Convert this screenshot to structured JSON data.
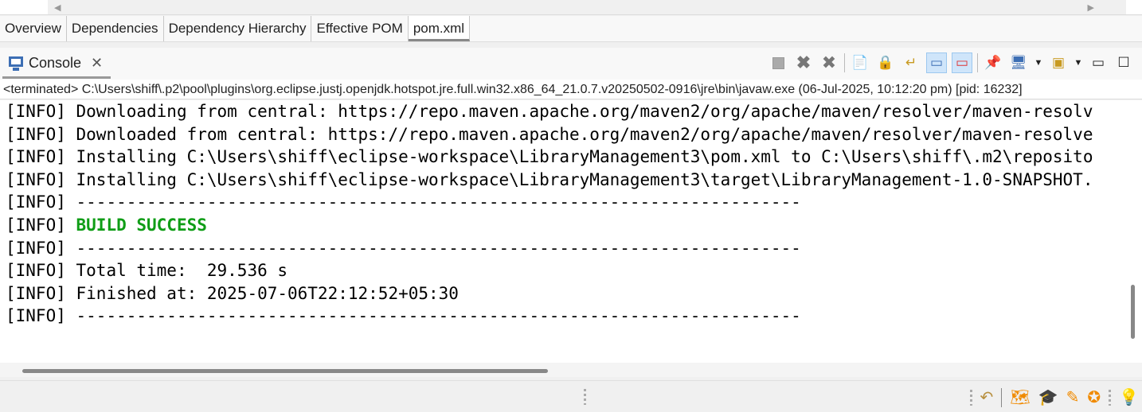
{
  "editor_tabs": [
    {
      "label": "Overview"
    },
    {
      "label": "Dependencies"
    },
    {
      "label": "Dependency Hierarchy"
    },
    {
      "label": "Effective POM"
    },
    {
      "label": "pom.xml",
      "active": true
    }
  ],
  "console_view": {
    "tab_label": "Console",
    "path": "<terminated> C:\\Users\\shiff\\.p2\\pool\\plugins\\org.eclipse.justj.openjdk.hotspot.jre.full.win32.x86_64_21.0.7.v20250502-0916\\jre\\bin\\javaw.exe (06-Jul-2025, 10:12:20 pm) [pid: 16232]"
  },
  "toolbar": [
    "terminate-icon",
    "remove-launch-icon",
    "remove-all-terminated-icon",
    "clear-console-icon",
    "scroll-lock-icon",
    "word-wrap-icon",
    "show-on-stdout-icon",
    "show-on-stderr-icon",
    "pin-console-icon",
    "display-selected-console-icon",
    "open-console-icon",
    "minimize-icon",
    "maximize-icon"
  ],
  "lines": [
    {
      "prefix": "[INFO] ",
      "text": "Downloading from central: https://repo.maven.apache.org/maven2/org/apache/maven/resolver/maven-resolv"
    },
    {
      "prefix": "[INFO] ",
      "text": "Downloaded from central: https://repo.maven.apache.org/maven2/org/apache/maven/resolver/maven-resolve"
    },
    {
      "prefix": "[INFO] ",
      "text": "Installing C:\\Users\\shiff\\eclipse-workspace\\LibraryManagement3\\pom.xml to C:\\Users\\shiff\\.m2\\reposito"
    },
    {
      "prefix": "[INFO] ",
      "text": "Installing C:\\Users\\shiff\\eclipse-workspace\\LibraryManagement3\\target\\LibraryManagement-1.0-SNAPSHOT."
    },
    {
      "prefix": "[INFO] ",
      "text": "------------------------------------------------------------------------"
    },
    {
      "prefix": "[INFO] ",
      "text": "BUILD SUCCESS",
      "success": true
    },
    {
      "prefix": "[INFO] ",
      "text": "------------------------------------------------------------------------"
    },
    {
      "prefix": "[INFO] ",
      "text": "Total time:  29.536 s"
    },
    {
      "prefix": "[INFO] ",
      "text": "Finished at: 2025-07-06T22:12:52+05:30"
    },
    {
      "prefix": "[INFO] ",
      "text": "------------------------------------------------------------------------"
    }
  ],
  "colors": {
    "success": "#0f9d16",
    "accent": "#f08a00"
  }
}
